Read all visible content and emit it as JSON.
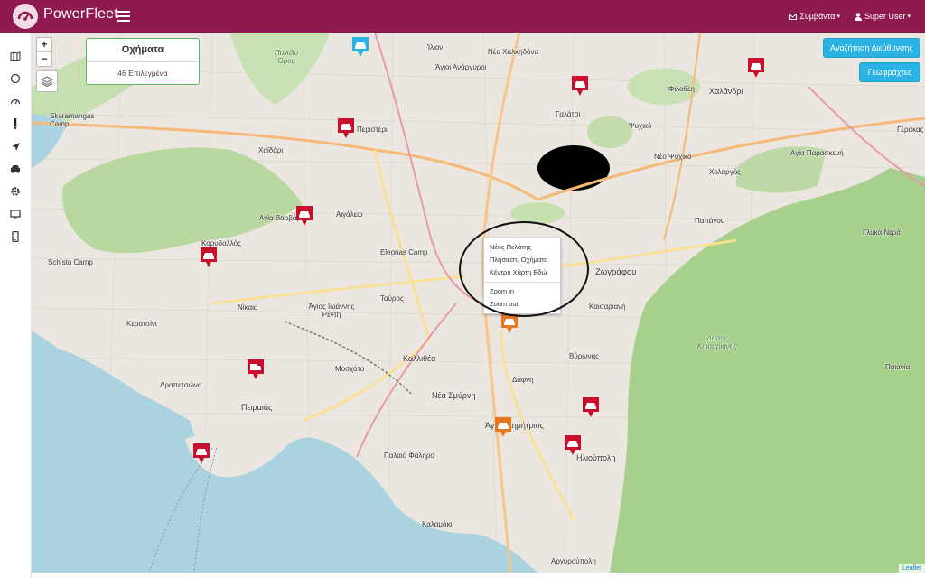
{
  "app": {
    "brand": "PowerFleet",
    "nav": {
      "events_label": "Συμβάντα",
      "user_label": "Super User"
    }
  },
  "sidebar": {
    "icons": [
      "map-icon",
      "circle-icon",
      "gauge-icon",
      "exclamation-icon",
      "navigation-arrow-icon",
      "car-icon",
      "gear-icon",
      "monitor-icon",
      "mobile-icon"
    ]
  },
  "map": {
    "zoom_in": "+",
    "zoom_out": "−",
    "vehicles_panel": {
      "title": "Οχήματα",
      "selected": "46 Επιλεγμένα"
    },
    "buttons": {
      "address_search": "Αναζήτηση Διεύθυνσης",
      "geofences": "Γεωφράχτες"
    },
    "context_menu": {
      "items_top": [
        "Νέος Πελάτης",
        "Πλησιέστ. Οχήματα",
        "Κέντρο Χάρτη Εδώ"
      ],
      "items_bottom": [
        "Zoom in",
        "Zoom out"
      ]
    },
    "attribution": "Leaflet",
    "colors": {
      "brand": "#8f1a4f",
      "accent": "#2bb4e3",
      "marker_red": "#c8102e",
      "marker_orange": "#e87722",
      "marker_blue": "#2bb4e3"
    },
    "places": [
      {
        "id": "ilion",
        "label": "Ίλιον"
      },
      {
        "id": "ag-anargyroi",
        "label": "Άγιοι Ανάργυροι"
      },
      {
        "id": "nea-chalkidona",
        "label": "Νέα Χαλκηδόνα"
      },
      {
        "id": "poikilo-oros",
        "label": "Ποικίλο Όρος",
        "green": true
      },
      {
        "id": "skaramangas",
        "label": "Skaramangas Camp"
      },
      {
        "id": "peristeri",
        "label": "Περιστέρι"
      },
      {
        "id": "chaidari",
        "label": "Χαϊδάρι"
      },
      {
        "id": "galatsi",
        "label": "Γαλάτσι"
      },
      {
        "id": "filothei",
        "label": "Φιλοθέη"
      },
      {
        "id": "chalandri",
        "label": "Χαλάνδρι"
      },
      {
        "id": "psychiko",
        "label": "Ψυχικό"
      },
      {
        "id": "neo-psychiko",
        "label": "Νέο Ψυχικό"
      },
      {
        "id": "cholargos",
        "label": "Χολαργός"
      },
      {
        "id": "agia-paraskevi",
        "label": "Αγία Παρασκευή"
      },
      {
        "id": "gerakas",
        "label": "Γέρακας"
      },
      {
        "id": "agia-varvara",
        "label": "Αγία Βαρβάρα"
      },
      {
        "id": "aigaleo",
        "label": "Αιγάλεω"
      },
      {
        "id": "korydallos",
        "label": "Κορυδαλλός"
      },
      {
        "id": "eleonas",
        "label": "Eleonas Camp"
      },
      {
        "id": "papagou",
        "label": "Παπάγου"
      },
      {
        "id": "glyka-nera",
        "label": "Γλυκά Νερά"
      },
      {
        "id": "schisto",
        "label": "Schisto Camp"
      },
      {
        "id": "zografou",
        "label": "Ζωγράφου"
      },
      {
        "id": "tavros",
        "label": "Ταύρος"
      },
      {
        "id": "nikaia",
        "label": "Νίκαια"
      },
      {
        "id": "ag-ioannis",
        "label": "Άγιος Ιωάννης Ρέντη"
      },
      {
        "id": "kaisariani",
        "label": "Καισαριανή"
      },
      {
        "id": "keratsini",
        "label": "Κερατσίνι"
      },
      {
        "id": "vyronas",
        "label": "Βύρωνας"
      },
      {
        "id": "moschato",
        "label": "Μοσχάτο"
      },
      {
        "id": "kallithea",
        "label": "Καλλιθέα"
      },
      {
        "id": "drapetsona",
        "label": "Δραπετσώνα"
      },
      {
        "id": "dafni",
        "label": "Δάφνη"
      },
      {
        "id": "paiania",
        "label": "Παιανία"
      },
      {
        "id": "peiraias",
        "label": "Πειραιάς"
      },
      {
        "id": "nea-smyrni",
        "label": "Νέα Σμύρνη"
      },
      {
        "id": "ag-dimitrios",
        "label": "Άγιος Δημήτριος"
      },
      {
        "id": "ilioupoli",
        "label": "Ηλιούπολη"
      },
      {
        "id": "palaio-faliro",
        "label": "Παλαιό Φάληρο"
      },
      {
        "id": "kalamaki",
        "label": "Καλαμάκι"
      },
      {
        "id": "argyroupoli",
        "label": "Αργυρούπολη"
      },
      {
        "id": "dasos-kaisarianis",
        "label": "Δάσος Καισαριανής",
        "green": true
      }
    ]
  }
}
